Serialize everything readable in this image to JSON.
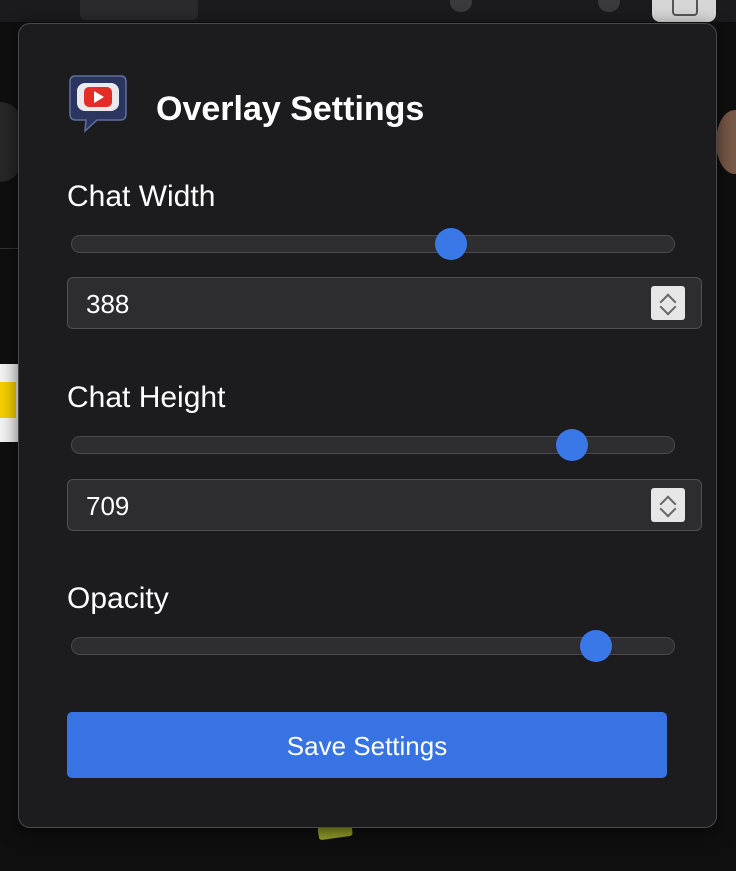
{
  "popup": {
    "title": "Overlay Settings",
    "logo_icon": "youtube-chat-bubble-icon",
    "accent_color": "#3b78e7",
    "chat_width": {
      "label": "Chat Width",
      "value": "388",
      "slider_fraction": 0.63
    },
    "chat_height": {
      "label": "Chat Height",
      "value": "709",
      "slider_fraction": 0.83
    },
    "opacity": {
      "label": "Opacity",
      "slider_fraction": 0.87
    },
    "save_label": "Save Settings"
  }
}
